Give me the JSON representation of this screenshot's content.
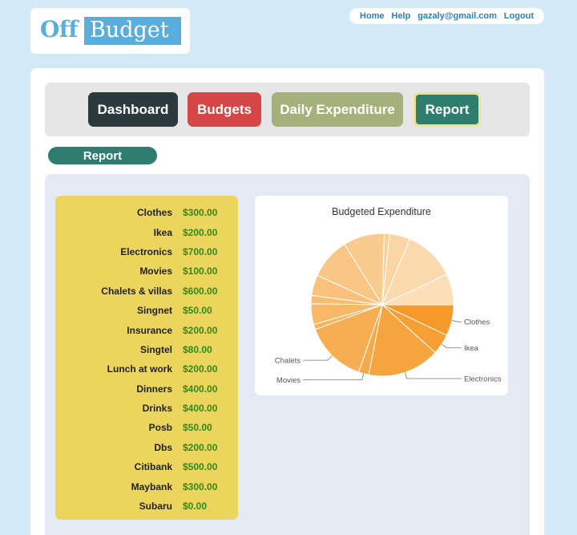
{
  "logo": {
    "part1": "Off",
    "part2": "Budget"
  },
  "topnav": {
    "home": "Home",
    "help": "Help",
    "user": "gazaly@gmail.com",
    "logout": "Logout"
  },
  "tabs": {
    "dashboard": "Dashboard",
    "budgets": "Budgets",
    "daily": "Daily Expenditure",
    "report": "Report"
  },
  "section_title": "Report",
  "budget_items": [
    {
      "name": "Clothes",
      "amount": "$300.00"
    },
    {
      "name": "Ikea",
      "amount": "$200.00"
    },
    {
      "name": "Electronics",
      "amount": "$700.00"
    },
    {
      "name": "Movies",
      "amount": "$100.00"
    },
    {
      "name": "Chalets & villas",
      "amount": "$600.00"
    },
    {
      "name": "Singnet",
      "amount": "$50.00"
    },
    {
      "name": "Insurance",
      "amount": "$200.00"
    },
    {
      "name": "Singtel",
      "amount": "$80.00"
    },
    {
      "name": "Lunch at work",
      "amount": "$200.00"
    },
    {
      "name": "Dinners",
      "amount": "$400.00"
    },
    {
      "name": "Drinks",
      "amount": "$400.00"
    },
    {
      "name": "Posb",
      "amount": "$50.00"
    },
    {
      "name": "Dbs",
      "amount": "$200.00"
    },
    {
      "name": "Citibank",
      "amount": "$500.00"
    },
    {
      "name": "Maybank",
      "amount": "$300.00"
    },
    {
      "name": "Subaru",
      "amount": "$0.00"
    }
  ],
  "chart_data": {
    "type": "pie",
    "title": "Budgeted Expenditure",
    "labels": [
      "Clothes",
      "Ikea",
      "Electronics",
      "Movies",
      "Chalets",
      "Singnet",
      "Insurance",
      "Singtel",
      "Lunch at work",
      "Dinners",
      "Drinks",
      "Posb",
      "Dbs",
      "Citibank",
      "Maybank",
      "Subaru"
    ],
    "values": [
      300,
      200,
      700,
      100,
      600,
      50,
      200,
      80,
      200,
      400,
      400,
      50,
      200,
      500,
      300,
      0
    ],
    "shown_labels": [
      "Clothes",
      "Ikea",
      "Electronics",
      "Movies",
      "Chalets"
    ],
    "color_start": "#f59a2a",
    "color_end": "#fce4c2"
  }
}
